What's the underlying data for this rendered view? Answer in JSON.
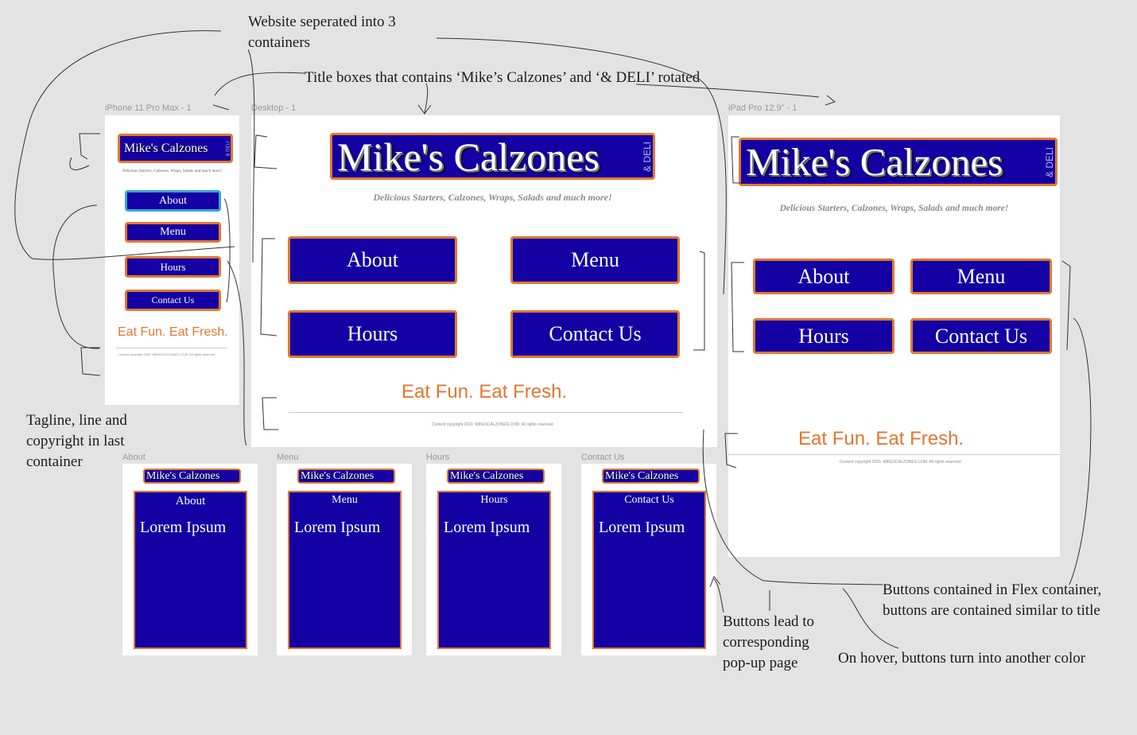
{
  "annotations": {
    "containers": "Website seperated into 3 containers",
    "title_boxes": "Title boxes that contains ‘Mike’s Calzones’ and ‘& DELI’ rotated",
    "tagline_note": "Tagline, line and copyright in last container",
    "popup_note": "Buttons lead to corresponding pop-up page",
    "flex_note": "Buttons contained in Flex container, buttons are contained similar to title",
    "hover_note": "On hover, buttons turn into another color"
  },
  "artboards": {
    "iphone": "iPhone 11 Pro Max - 1",
    "desktop": "Desktop - 1",
    "ipad": "iPad Pro 12.9\" - 1",
    "about": "About",
    "menu": "Menu",
    "hours": "Hours",
    "contact": "Contact Us"
  },
  "site": {
    "title": "Mike's Calzones",
    "deli": "& DELI",
    "tagline": "Delicious Starters, Calzones, Wraps, Salads and much more!",
    "eat": "Eat Fun. Eat Fresh.",
    "copyright": "Content copyright 2020. MIKESCALZONES.COM. All rights reserved."
  },
  "buttons": {
    "about": "About",
    "menu": "Menu",
    "hours": "Hours",
    "contact": "Contact Us"
  },
  "popup": {
    "lorem": "Lorem Ipsum"
  },
  "colors": {
    "brand_blue": "#1400a3",
    "accent_orange": "#e3772e",
    "hover_outline": "#3aa3d8"
  }
}
